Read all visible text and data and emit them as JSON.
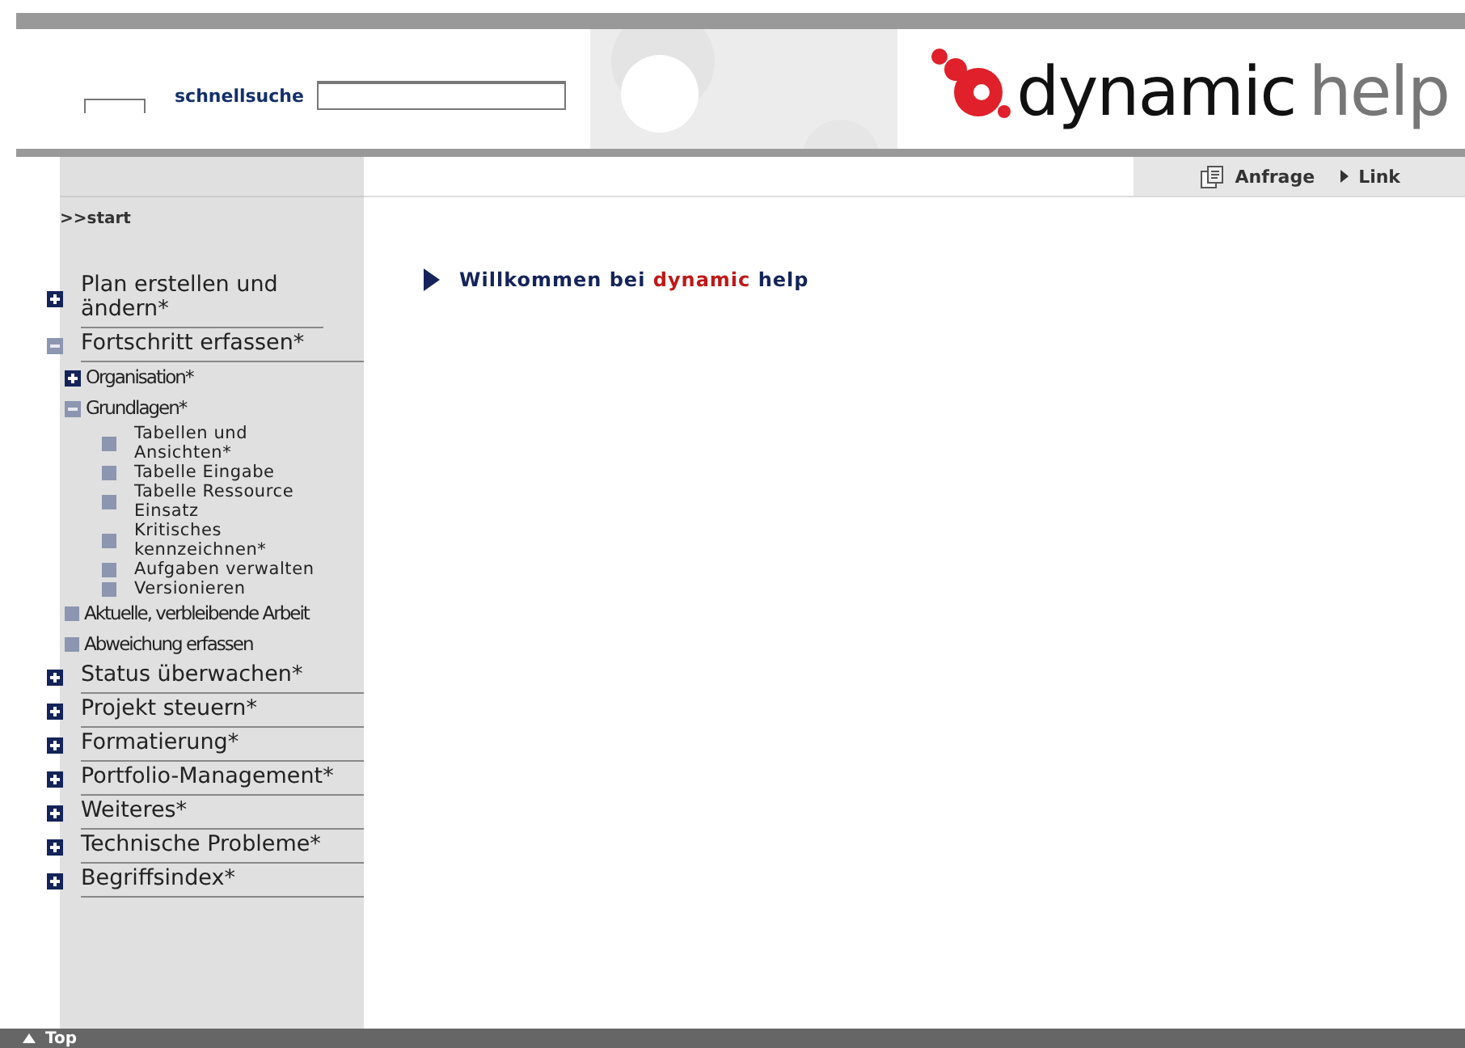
{
  "header": {
    "search_label": "schnellsuche",
    "logo": {
      "first": "dynamic",
      "second": "help"
    }
  },
  "toolbar": {
    "links": [
      {
        "label": "Anfrage",
        "kind": "request"
      },
      {
        "label": "Link",
        "kind": "arrow"
      }
    ]
  },
  "sidebar": {
    "breadcrumb": ">>start",
    "items": [
      {
        "label": "Plan erstellen und ändern*",
        "kind": "folder",
        "expanded": false
      },
      {
        "label": "Fortschritt erfassen*",
        "kind": "folder",
        "expanded": true,
        "children": [
          {
            "label": "Organisation*",
            "kind": "folder",
            "expanded": false
          },
          {
            "label": "Grundlagen*",
            "kind": "folder",
            "expanded": true,
            "children": [
              {
                "label": "Tabellen und Ansichten*",
                "kind": "page"
              },
              {
                "label": "Tabelle Eingabe",
                "kind": "page"
              },
              {
                "label": "Tabelle Ressource Einsatz",
                "kind": "page"
              },
              {
                "label": "Kritisches kennzeichnen*",
                "kind": "page"
              },
              {
                "label": "Aufgaben verwalten",
                "kind": "page"
              },
              {
                "label": "Versionieren",
                "kind": "page"
              }
            ]
          },
          {
            "label": "Aktuelle, verbleibende Arbeit",
            "kind": "page"
          },
          {
            "label": "Abweichung erfassen",
            "kind": "page"
          }
        ]
      },
      {
        "label": "Status überwachen*",
        "kind": "folder",
        "expanded": false
      },
      {
        "label": "Projekt steuern*",
        "kind": "folder",
        "expanded": false
      },
      {
        "label": "Formatierung*",
        "kind": "folder",
        "expanded": false
      },
      {
        "label": "Portfolio-Management*",
        "kind": "folder",
        "expanded": false
      },
      {
        "label": "Weiteres*",
        "kind": "folder",
        "expanded": false
      },
      {
        "label": "Technische Probleme*",
        "kind": "folder",
        "expanded": false
      },
      {
        "label": "Begriffsindex*",
        "kind": "folder",
        "expanded": false
      }
    ]
  },
  "content": {
    "heading": {
      "before": "Willkommen bei",
      "accent": "dynamic",
      "after": "help"
    }
  },
  "footer": {
    "link": "Top"
  }
}
